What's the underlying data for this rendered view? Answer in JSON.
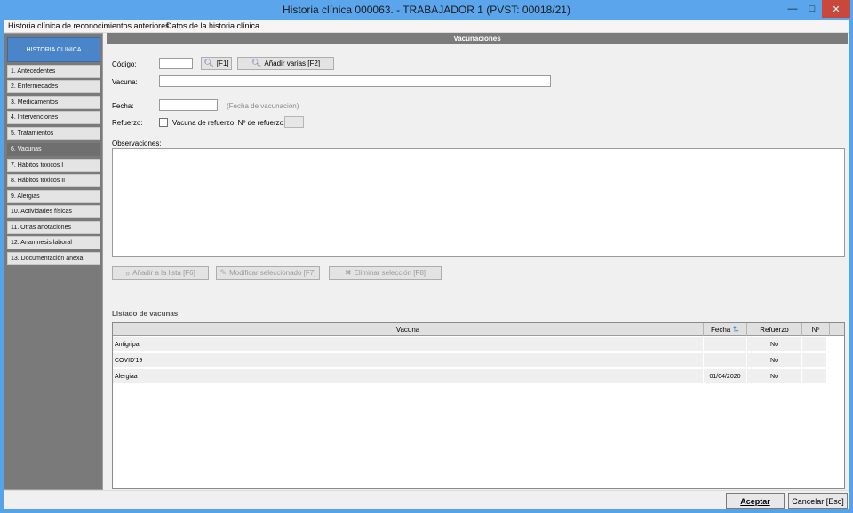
{
  "window": {
    "title": "Historia clínica 000063.  - TRABAJADOR 1   (PVST: 00018/21)",
    "minimize_icon": "minimize-icon",
    "maximize_icon": "maximize-icon",
    "close_icon": "close-icon"
  },
  "menu": [
    "Historia clínica de reconocimientos anteriores",
    "Datos de la historia clínica"
  ],
  "sidebar": {
    "header": "HISTORIA CLINICA",
    "items": [
      {
        "label": "1. Antecedentes"
      },
      {
        "label": "2. Enfermedades"
      },
      {
        "label": "3. Medicamentos"
      },
      {
        "label": "4. Intervenciones"
      },
      {
        "label": "5. Tratamientos"
      },
      {
        "label": "6. Vacunas"
      },
      {
        "label": "7. Hábitos tóxicos I"
      },
      {
        "label": "8. Hábitos tóxicos II"
      },
      {
        "label": "9. Alergias"
      },
      {
        "label": "10. Actividades físicas"
      },
      {
        "label": "11. Otras anotaciones"
      },
      {
        "label": "12. Anamnesis laboral"
      },
      {
        "label": "13. Documentación anexa"
      }
    ],
    "active": "6. Vacunas"
  },
  "panel": {
    "title": "Vacunaciones",
    "codigo_label": "Código:",
    "codigo_value": "",
    "search_btn": "[F1]",
    "add_multi_btn": "Añadir varias  [F2]",
    "vacuna_label": "Vacuna:",
    "vacuna_value": "",
    "fecha_label": "Fecha:",
    "fecha_value": "",
    "fecha_hint": "(Fecha de vacunación)",
    "refuerzo_label": "Refuerzo:",
    "refuerzo_check_label": "Vacuna de refuerzo. Nº de refuerzo:",
    "refuerzo_num": "",
    "observaciones_label": "Observaciones:",
    "observaciones_value": "",
    "add_list_btn": "Añadir a la lista  [F6]",
    "modify_btn": "Modificar seleccionado  [F7]",
    "delete_btn": "Eliminar selección  [F8]",
    "list_title": "Listado de vacunas"
  },
  "table": {
    "headers": {
      "vacuna": "Vacuna",
      "fecha": "Fecha",
      "refuerzo": "Refuerzo",
      "num": "Nº"
    },
    "rows": [
      {
        "vacuna": "Antigripal",
        "fecha": "",
        "refuerzo": "No",
        "num": ""
      },
      {
        "vacuna": "COVID'19",
        "fecha": "",
        "refuerzo": "No",
        "num": ""
      },
      {
        "vacuna": "Alergiaa",
        "fecha": "01/04/2020",
        "refuerzo": "No",
        "num": ""
      }
    ]
  },
  "footer": {
    "accept": "Aceptar",
    "cancel": "Cancelar [Esc]"
  }
}
